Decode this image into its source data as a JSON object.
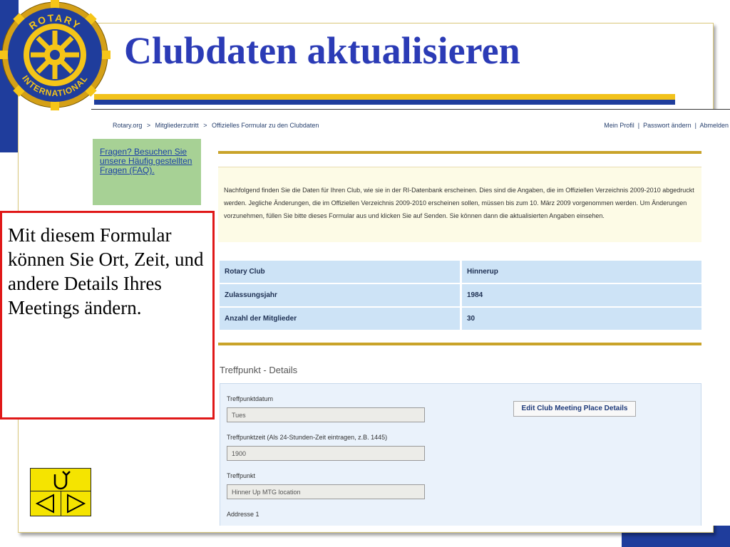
{
  "slide": {
    "title": "Clubdaten aktualisieren",
    "callout_text": "Mit diesem Formular können Sie Ort, Zeit, und andere Details Ihres Meetings ändern.",
    "logo_text_top": "ROTARY",
    "logo_text_bottom": "INTERNATIONAL"
  },
  "breadcrumb": {
    "items": [
      "Rotary.org",
      "Mitgliederzutritt",
      "Offizielles Formular zu den Clubdaten"
    ],
    "separator": ">"
  },
  "top_links": [
    "Mein Profil",
    "Passwort ändern",
    "Abmelden"
  ],
  "faq_link": "Fragen? Besuchen Sie unsere Häufig gestellten Fragen (FAQ).",
  "intro_text": "Nachfolgend finden Sie die Daten für Ihren Club, wie sie in der RI-Datenbank erscheinen. Dies sind die Angaben, die im Offiziellen Verzeichnis 2009-2010 abgedruckt werden. Jegliche Änderungen, die im Offiziellen Verzeichnis 2009-2010 erscheinen sollen, müssen bis zum 10. März 2009 vorgenommen werden. Um Änderungen vorzunehmen, füllen Sie bitte dieses Formular aus und klicken Sie auf Senden. Sie können dann die aktualisierten Angaben einsehen.",
  "club_table": [
    {
      "label": "Rotary Club",
      "value": "Hinnerup"
    },
    {
      "label": "Zulassungsjahr",
      "value": "1984"
    },
    {
      "label": "Anzahl der Mitglieder",
      "value": "30"
    }
  ],
  "meeting": {
    "section_title": "Treffpunkt - Details",
    "day_label": "Treffpunktdatum",
    "day_value": "Tues",
    "time_label": "Treffpunktzeit (Als 24-Stunden-Zeit eintragen, z.B. 1445)",
    "time_value": "1900",
    "place_label": "Treffpunkt",
    "place_value": "Hinner Up MTG location",
    "address_label": "Addresse 1",
    "edit_button": "Edit Club Meeting Place Details"
  },
  "colors": {
    "title": "#2b3bb6",
    "navy": "#1f3d9c",
    "gold": "#f2c21b",
    "callout_border": "#e01818",
    "faq_bg": "#a7d195",
    "table_bg": "#cde3f6"
  },
  "icons": {
    "nav_top": "return-icon",
    "nav_prev": "triangle-left-icon",
    "nav_next": "triangle-right-icon"
  }
}
